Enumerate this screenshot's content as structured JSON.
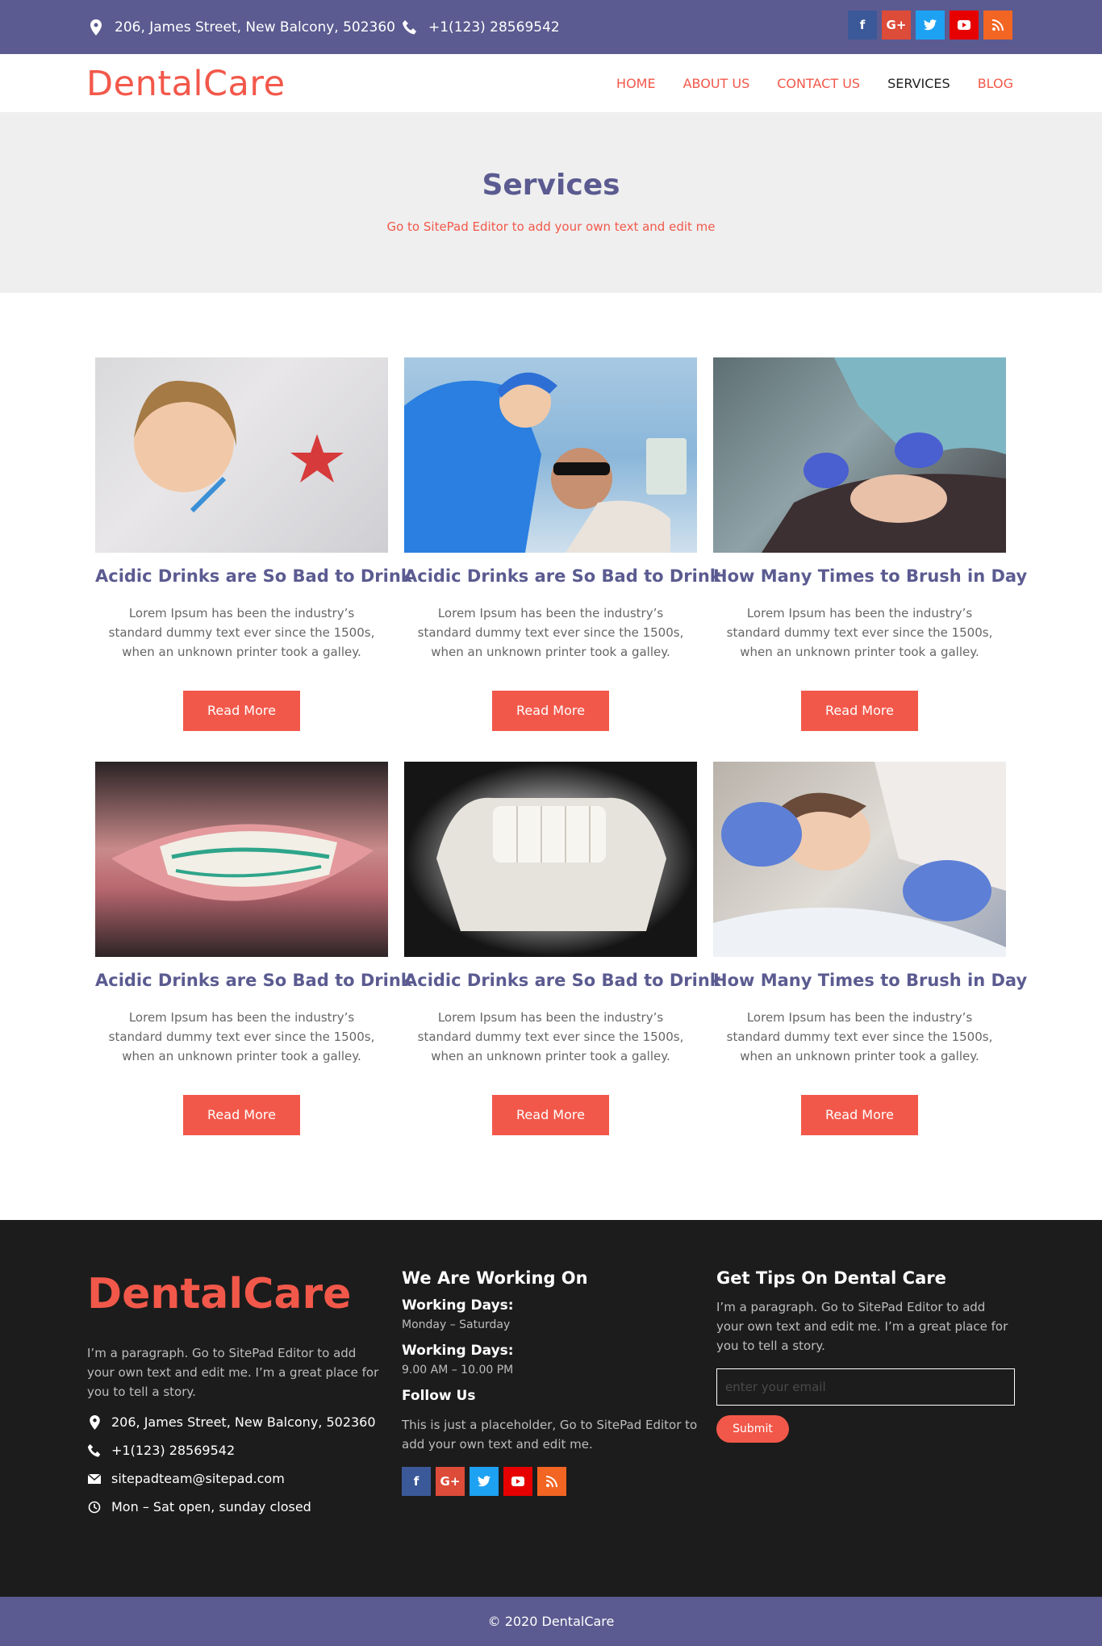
{
  "topbar": {
    "address": "206, James Street, New Balcony, 502360",
    "phone": "+1(123) 28569542",
    "social": [
      {
        "name": "facebook-icon",
        "glyph": "f",
        "color": "#3b5998"
      },
      {
        "name": "google-plus-icon",
        "glyph": "G+",
        "color": "#dd4b39"
      },
      {
        "name": "twitter-icon",
        "glyph": "t",
        "color": "#1da1f2"
      },
      {
        "name": "youtube-icon",
        "glyph": "▶",
        "color": "#e60000"
      },
      {
        "name": "rss-icon",
        "glyph": "☰",
        "color": "#f26522"
      }
    ]
  },
  "header": {
    "logo": "DentalCare",
    "nav": [
      {
        "label": "HOME",
        "active": false
      },
      {
        "label": "ABOUT US",
        "active": false
      },
      {
        "label": "CONTACT US",
        "active": false
      },
      {
        "label": "SERVICES",
        "active": true
      },
      {
        "label": "BLOG",
        "active": false
      }
    ]
  },
  "hero": {
    "title": "Services",
    "subtitle": "Go to SitePad Editor to add your own text and edit me"
  },
  "services": [
    {
      "title": "Acidic Drinks are So Bad to Drink",
      "text": "Lorem Ipsum has been the industry’s standard dummy text ever since the 1500s, when an unknown printer took a galley.",
      "button": "Read More"
    },
    {
      "title": "Acidic Drinks are So Bad to Drink",
      "text": "Lorem Ipsum has been the industry’s standard dummy text ever since the 1500s, when an unknown printer took a galley.",
      "button": "Read More"
    },
    {
      "title": "How Many Times to Brush in Day",
      "text": "Lorem Ipsum has been the industry’s standard dummy text ever since the 1500s, when an unknown printer took a galley.",
      "button": "Read More"
    },
    {
      "title": "Acidic Drinks are So Bad to Drink",
      "text": "Lorem Ipsum has been the industry’s standard dummy text ever since the 1500s, when an unknown printer took a galley.",
      "button": "Read More"
    },
    {
      "title": "Acidic Drinks are So Bad to Drink",
      "text": "Lorem Ipsum has been the industry’s standard dummy text ever since the 1500s, when an unknown printer took a galley.",
      "button": "Read More"
    },
    {
      "title": "How Many Times to Brush in Day",
      "text": "Lorem Ipsum has been the industry’s standard dummy text ever since the 1500s, when an unknown printer took a galley.",
      "button": "Read More"
    }
  ],
  "footer": {
    "logo": "DentalCare",
    "about": "I’m a paragraph. Go to SitePad Editor to add your own text and edit me. I’m a great place for you to tell a story.",
    "address": "206, James Street, New Balcony, 502360",
    "phone": "+1(123) 28569542",
    "email": "sitepadteam@sitepad.com",
    "hours": "Mon – Sat open, sunday closed",
    "working_title": "We Are Working On",
    "days_label": "Working Days:",
    "days_value": "Monday – Saturday",
    "hours_label": "Working Days:",
    "hours_value": "9.00 AM – 10.00 PM",
    "follow_title": "Follow Us",
    "follow_text": "This is just a placeholder, Go to SitePad Editor to add your own text and edit me.",
    "tips_title": "Get Tips On Dental Care",
    "tips_text": "I’m a paragraph. Go to SitePad Editor to add your own text and edit me. I’m a great place for you to tell a story.",
    "email_placeholder": "enter your email",
    "submit": "Submit",
    "copyright": "© 2020 DentalCare"
  }
}
